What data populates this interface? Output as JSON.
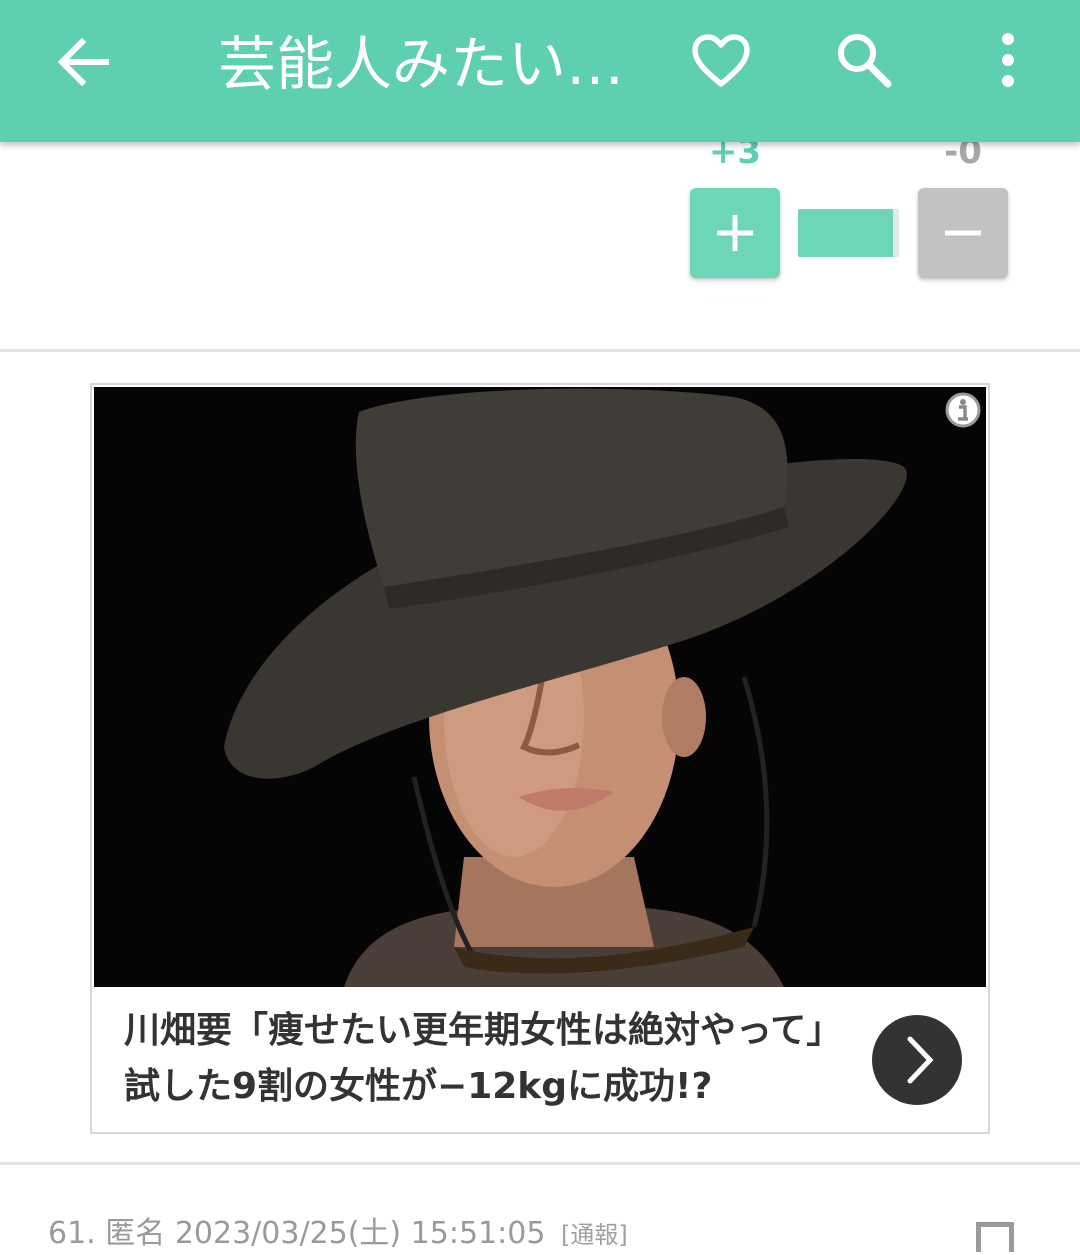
{
  "app_bar": {
    "title": "芸能人みたい…",
    "background": "#5ecfb1",
    "icons": [
      "back-arrow-icon",
      "heart-icon",
      "search-icon",
      "more-vert-icon"
    ]
  },
  "vote": {
    "plus_count": "+3",
    "minus_count": "-0",
    "plus_ratio": 0.94,
    "plus_color": "#6dd5b8",
    "minus_color": "#c2c2c2"
  },
  "ad": {
    "headline": "川畑要「痩せたい更年期女性は絶対やって」試した9割の女性が−12kgに成功!?",
    "image": "man-in-black-hat-photo",
    "info_icon": "info-icon",
    "action_icon": "chevron-right-icon"
  },
  "next_comment": {
    "number": "61.",
    "author": "匿名",
    "timestamp": "2023/03/25(土) 15:51:05",
    "report_label": "[通報]"
  }
}
